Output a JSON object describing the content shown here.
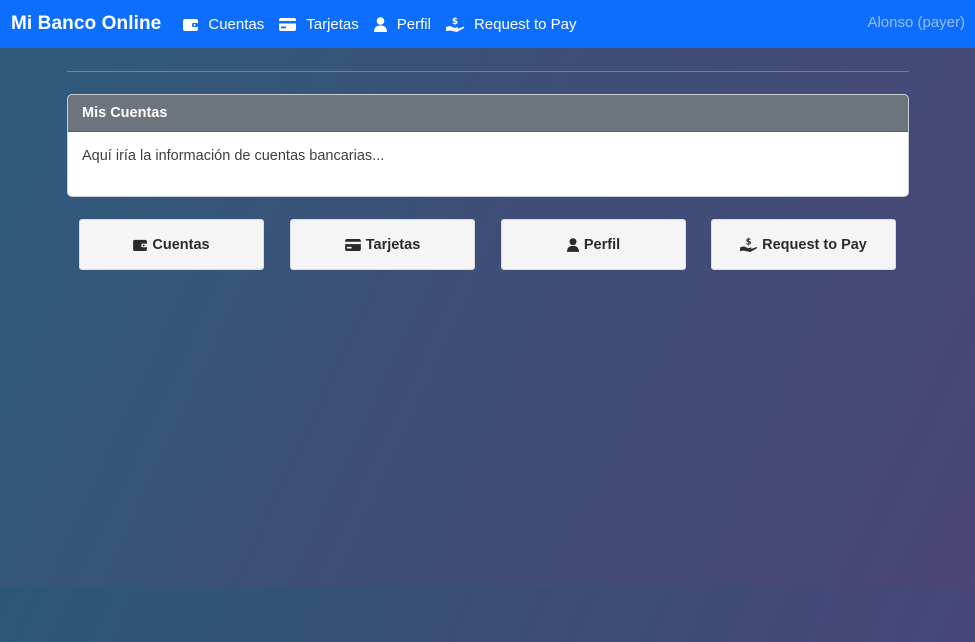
{
  "navbar": {
    "brand": "Mi Banco Online",
    "links": [
      {
        "label": "Cuentas",
        "icon": "wallet-icon"
      },
      {
        "label": "Tarjetas",
        "icon": "credit-card-icon"
      },
      {
        "label": "Perfil",
        "icon": "user-icon"
      },
      {
        "label": "Request to Pay",
        "icon": "hand-dollar-icon"
      }
    ],
    "user": "Alonso (payer)"
  },
  "card": {
    "title": "Mis Cuentas",
    "body": "Aquí iría la información de cuentas bancarias..."
  },
  "buttons": [
    {
      "label": "Cuentas",
      "icon": "wallet-icon"
    },
    {
      "label": "Tarjetas",
      "icon": "credit-card-icon"
    },
    {
      "label": "Perfil",
      "icon": "user-icon"
    },
    {
      "label": "Request to Pay",
      "icon": "hand-dollar-icon"
    }
  ],
  "colors": {
    "navbar": "#0d6efd",
    "card_header": "#6c757d",
    "button_bg": "#f5f5f5"
  }
}
